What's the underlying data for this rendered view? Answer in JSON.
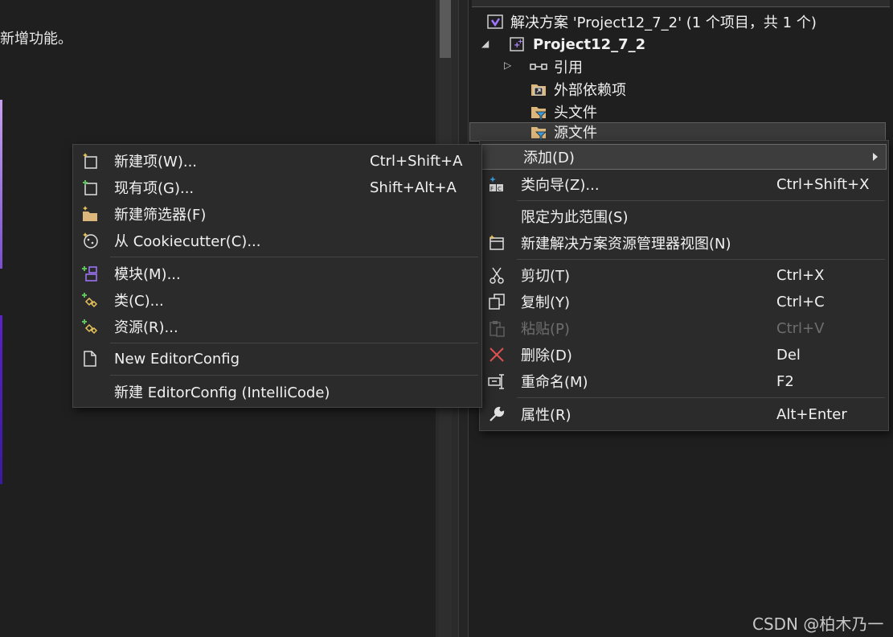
{
  "left_pane": {
    "text_fragment": "新增功能。"
  },
  "solution_explorer": {
    "rows": [
      {
        "label": "解决方案 'Project12_7_2' (1 个项目，共 1 个)",
        "icon": "solution-icon"
      },
      {
        "label": "Project12_7_2",
        "icon": "cpp-project-icon"
      },
      {
        "label": "引用",
        "icon": "references-icon"
      },
      {
        "label": "外部依赖项",
        "icon": "external-deps-icon"
      },
      {
        "label": "头文件",
        "icon": "filter-folder-icon"
      },
      {
        "label": "源文件",
        "icon": "filter-folder-icon"
      }
    ]
  },
  "context_menu": {
    "items": [
      {
        "label": "添加(D)",
        "shortcut": "",
        "icon": ""
      },
      {
        "label": "类向导(Z)...",
        "shortcut": "Ctrl+Shift+X",
        "icon": "class-wizard-icon"
      },
      {
        "label": "限定为此范围(S)",
        "shortcut": "",
        "icon": ""
      },
      {
        "label": "新建解决方案资源管理器视图(N)",
        "shortcut": "",
        "icon": "new-view-icon"
      },
      {
        "label": "剪切(T)",
        "shortcut": "Ctrl+X",
        "icon": "cut-icon"
      },
      {
        "label": "复制(Y)",
        "shortcut": "Ctrl+C",
        "icon": "copy-icon"
      },
      {
        "label": "粘贴(P)",
        "shortcut": "Ctrl+V",
        "icon": "paste-icon",
        "disabled": true
      },
      {
        "label": "删除(D)",
        "shortcut": "Del",
        "icon": "delete-icon"
      },
      {
        "label": "重命名(M)",
        "shortcut": "F2",
        "icon": "rename-icon"
      },
      {
        "label": "属性(R)",
        "shortcut": "Alt+Enter",
        "icon": "wrench-icon"
      }
    ]
  },
  "add_submenu": {
    "items": [
      {
        "label": "新建项(W)...",
        "shortcut": "Ctrl+Shift+A",
        "icon": "new-item-icon"
      },
      {
        "label": "现有项(G)...",
        "shortcut": "Shift+Alt+A",
        "icon": "existing-item-icon"
      },
      {
        "label": "新建筛选器(F)",
        "shortcut": "",
        "icon": "new-filter-icon"
      },
      {
        "label": "从 Cookiecutter(C)...",
        "shortcut": "",
        "icon": "cookiecutter-icon"
      },
      {
        "label": "模块(M)...",
        "shortcut": "",
        "icon": "module-icon"
      },
      {
        "label": "类(C)...",
        "shortcut": "",
        "icon": "class-icon"
      },
      {
        "label": "资源(R)...",
        "shortcut": "",
        "icon": "resource-icon"
      },
      {
        "label": "New EditorConfig",
        "shortcut": "",
        "icon": "file-icon"
      },
      {
        "label": "新建 EditorConfig (IntelliCode)",
        "shortcut": "",
        "icon": ""
      }
    ]
  },
  "watermark": "CSDN @柏木乃一",
  "colors": {
    "background": "#1f1f1f",
    "menu": "#2b2b2b",
    "accent_purple": "#6b2fbf",
    "delete_red": "#e05252"
  }
}
